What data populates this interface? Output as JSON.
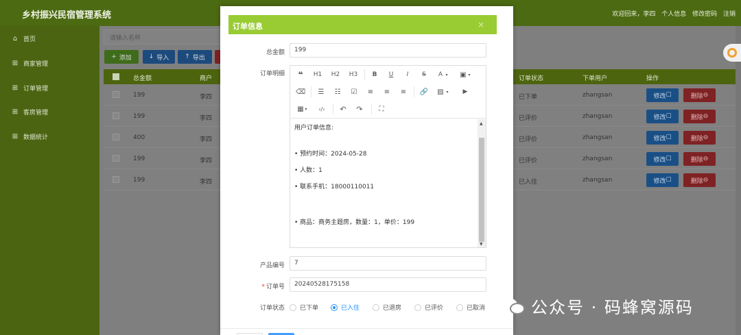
{
  "app": {
    "title": "乡村振兴民宿管理系统",
    "header_links": [
      "欢迎回来，李四",
      "个人信息",
      "修改密码",
      "注销"
    ]
  },
  "sidebar": {
    "items": [
      {
        "label": "首页",
        "icon": "home-icon"
      },
      {
        "label": "商家管理",
        "icon": "grid-icon"
      },
      {
        "label": "订单管理",
        "icon": "grid-icon"
      },
      {
        "label": "客房管理",
        "icon": "grid-icon"
      },
      {
        "label": "数据统计",
        "icon": "grid-icon"
      }
    ]
  },
  "toolbar": {
    "search_placeholder": "请输入名称",
    "add_label": "添加",
    "import_label": "导入",
    "export_label": "导出"
  },
  "table": {
    "columns": [
      "总金额",
      "商户",
      "订单状态",
      "下单用户",
      "操作"
    ],
    "rows": [
      {
        "total": "199",
        "merchant": "李四",
        "status": "已下单",
        "user": "zhangsan"
      },
      {
        "total": "199",
        "merchant": "李四",
        "status": "已评价",
        "user": "zhangsan"
      },
      {
        "total": "400",
        "merchant": "李四",
        "status": "已评价",
        "user": "zhangsan"
      },
      {
        "total": "199",
        "merchant": "李四",
        "status": "已评价",
        "user": "zhangsan"
      },
      {
        "total": "199",
        "merchant": "李四",
        "status": "已入住",
        "user": "zhangsan"
      }
    ],
    "edit_label": "修改",
    "delete_label": "删除"
  },
  "modal": {
    "title": "订单信息",
    "close": "×",
    "fields": {
      "total_label": "总金额",
      "total_value": "199",
      "detail_label": "订单明细",
      "product_label": "产品编号",
      "product_value": "7",
      "order_no_label": "订单号",
      "order_no_value": "20240528175158",
      "status_label": "订单状态"
    },
    "editor": {
      "toolbar": [
        "H1",
        "H2",
        "H3",
        "B",
        "U",
        "I",
        "S",
        "A"
      ],
      "content": [
        "用户订单信息:",
        "• 预约时间：2024-05-28",
        "• 人数：1",
        "• 联系手机：18000110011",
        "• 商品：商务主题房，数量：1，单价：199"
      ]
    },
    "status_options": [
      {
        "label": "已下单",
        "selected": false
      },
      {
        "label": "已入住",
        "selected": true
      },
      {
        "label": "已退房",
        "selected": false
      },
      {
        "label": "已评价",
        "selected": false
      },
      {
        "label": "已取消",
        "selected": false
      }
    ]
  },
  "watermark": {
    "text": "公众号 · 码蜂窝源码"
  },
  "colors": {
    "modal_header": "#99cc33",
    "radio_selected": "#1e90ff",
    "edit_button": "#1e88e5",
    "delete_button": "#e53935"
  }
}
